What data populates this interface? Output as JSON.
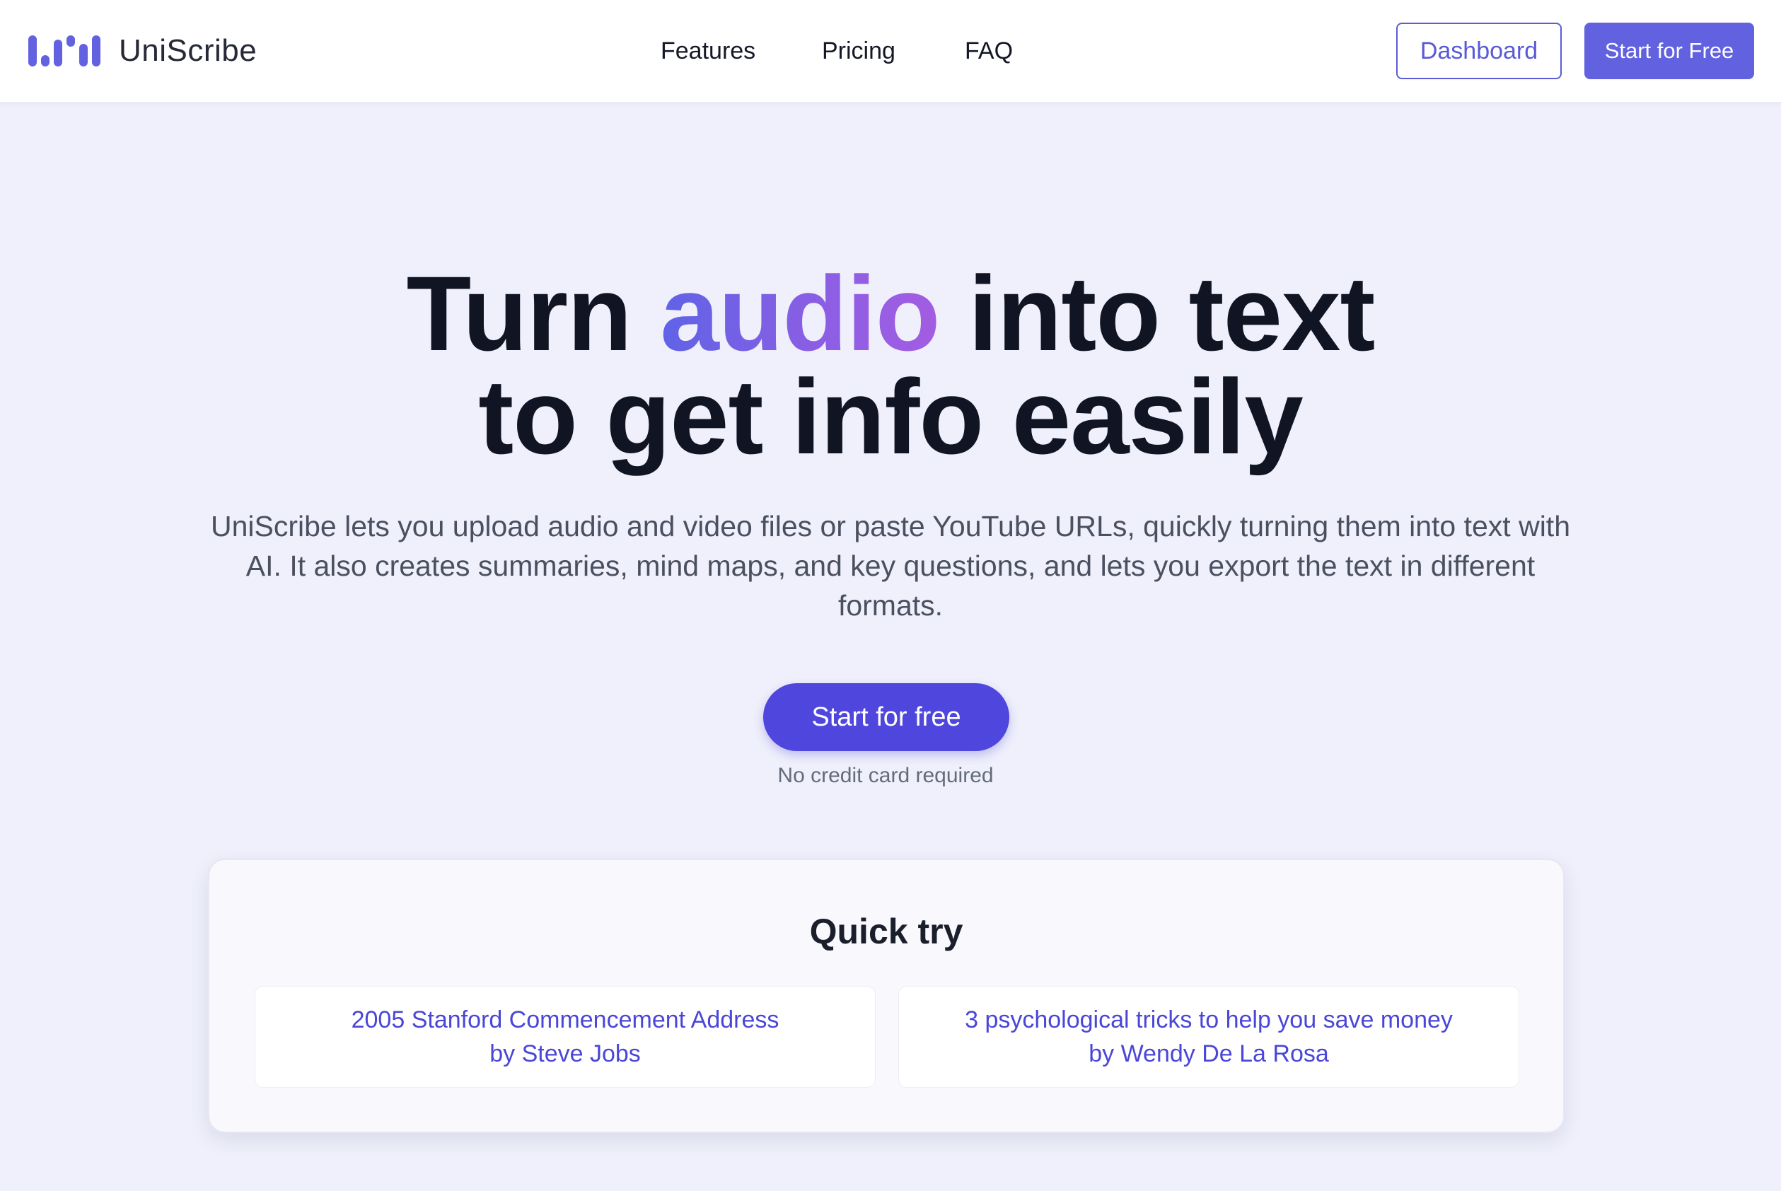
{
  "brand": {
    "name": "UniScribe",
    "logo_icon": "waveform-logo-icon",
    "accent": "#6262e0"
  },
  "nav": {
    "links": [
      "Features",
      "Pricing",
      "FAQ"
    ]
  },
  "header_actions": {
    "dashboard_label": "Dashboard",
    "start_label": "Start for Free"
  },
  "hero": {
    "title_part1": "Turn",
    "title_accent": "audio",
    "title_part2": "into text",
    "title_line2": "to get info easily",
    "subtitle": "UniScribe lets you upload audio and video files or paste YouTube URLs, quickly turning them into text with AI. It also creates summaries, mind maps, and key questions, and lets you export the text in different formats.",
    "cta_label": "Start for free",
    "cta_note": "No credit card required"
  },
  "quick_try": {
    "title": "Quick try",
    "items": [
      {
        "line1": "2005 Stanford Commencement Address",
        "line2": "by Steve Jobs"
      },
      {
        "line1": "3 psychological tricks to help you save money",
        "line2": "by Wendy De La Rosa"
      }
    ]
  },
  "colors": {
    "page_bg": "#eff0fb",
    "primary": "#4f46de",
    "link": "#4a46d8"
  }
}
